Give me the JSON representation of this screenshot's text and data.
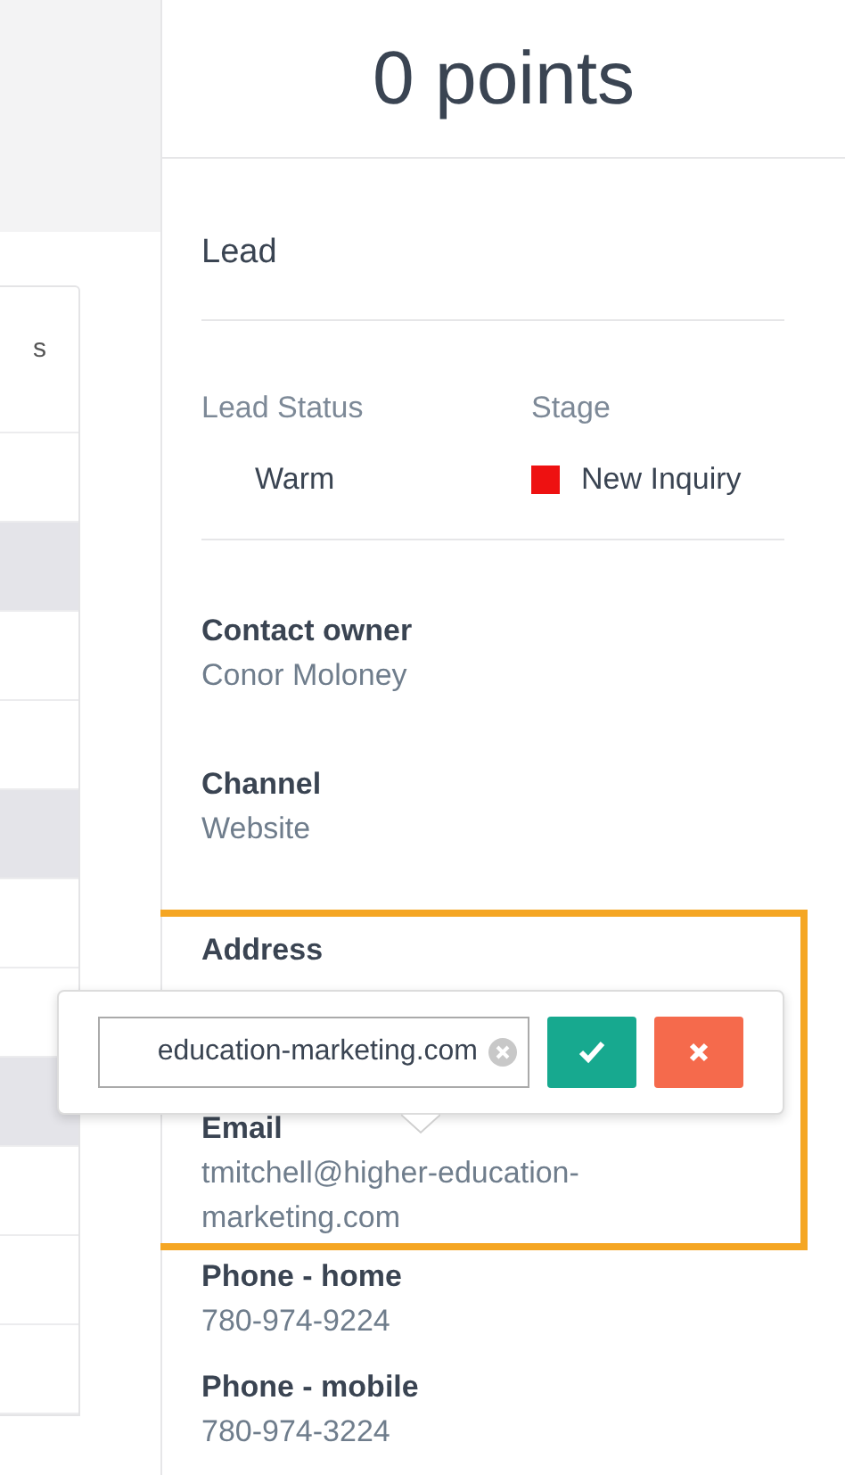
{
  "left_card": {
    "header_fragment": "s",
    "rows": [
      {
        "shaded": false
      },
      {
        "shaded": true
      },
      {
        "shaded": false
      },
      {
        "shaded": false
      },
      {
        "shaded": true
      },
      {
        "shaded": false
      },
      {
        "shaded": false
      },
      {
        "shaded": true
      },
      {
        "shaded": false
      },
      {
        "shaded": false
      },
      {
        "shaded": false
      }
    ]
  },
  "score": "0 points",
  "section_title": "Lead",
  "lead_status": {
    "label": "Lead Status",
    "value": "Warm"
  },
  "stage": {
    "label": "Stage",
    "value": "New Inquiry",
    "color": "#ee1111"
  },
  "fields": [
    {
      "label": "Contact owner",
      "value": "Conor Moloney"
    },
    {
      "label": "Channel",
      "value": "Website"
    },
    {
      "label": "Address",
      "highlighted": true
    },
    {
      "label": "Email",
      "value": "tmitchell@higher-education-marketing.com",
      "highlighted": true
    },
    {
      "label": "Phone - home",
      "value": "780-974-9224"
    },
    {
      "label": "Phone - mobile",
      "value": "780-974-3224"
    }
  ],
  "editor": {
    "value": "education-marketing.com"
  }
}
